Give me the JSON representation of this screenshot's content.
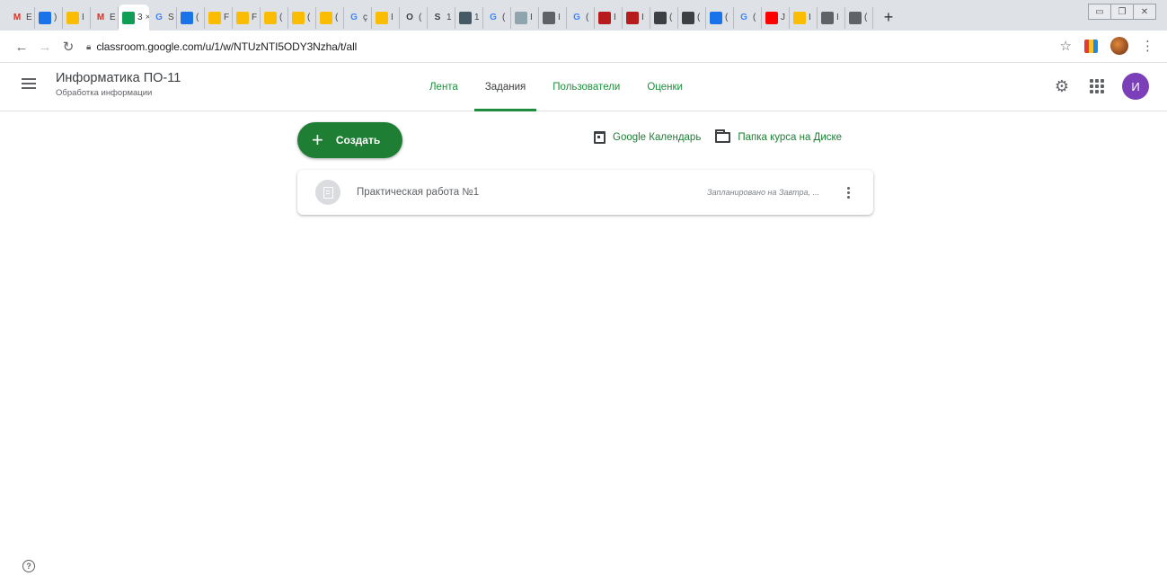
{
  "browser": {
    "tabs": [
      {
        "icon": "gmail-icon",
        "letter": "M",
        "color": "#d93025",
        "text": "E"
      },
      {
        "icon": "classroom-icon",
        "letter": "",
        "color": "#1a73e8",
        "text": ")"
      },
      {
        "icon": "classroom-icon",
        "letter": "",
        "color": "#fbbc04",
        "text": "I"
      },
      {
        "icon": "gmail-icon",
        "letter": "M",
        "color": "#d93025",
        "text": "E"
      },
      {
        "icon": "classroom-icon",
        "letter": "",
        "color": "#0f9d58",
        "text": "3",
        "active": true
      },
      {
        "icon": "google-icon",
        "letter": "G",
        "color": "#4285f4",
        "text": "S"
      },
      {
        "icon": "classroom-icon",
        "letter": "",
        "color": "#1a73e8",
        "text": "("
      },
      {
        "icon": "classroom-icon",
        "letter": "",
        "color": "#fbbc04",
        "text": "F"
      },
      {
        "icon": "classroom-icon",
        "letter": "",
        "color": "#fbbc04",
        "text": "F"
      },
      {
        "icon": "classroom-icon",
        "letter": "",
        "color": "#fbbc04",
        "text": "("
      },
      {
        "icon": "classroom-icon",
        "letter": "",
        "color": "#fbbc04",
        "text": "("
      },
      {
        "icon": "classroom-icon",
        "letter": "",
        "color": "#fbbc04",
        "text": "("
      },
      {
        "icon": "google-icon",
        "letter": "G",
        "color": "#4285f4",
        "text": "ç"
      },
      {
        "icon": "classroom-icon",
        "letter": "",
        "color": "#fbbc04",
        "text": "I"
      },
      {
        "icon": "site-icon",
        "letter": "O",
        "color": "#3c4043",
        "text": "("
      },
      {
        "icon": "site-icon",
        "letter": "S",
        "color": "#3c4043",
        "text": "1"
      },
      {
        "icon": "site-icon",
        "letter": "",
        "color": "#455a64",
        "text": "1"
      },
      {
        "icon": "google-icon",
        "letter": "G",
        "color": "#4285f4",
        "text": "("
      },
      {
        "icon": "site-icon",
        "letter": "",
        "color": "#90a4ae",
        "text": "I"
      },
      {
        "icon": "site-icon",
        "letter": "",
        "color": "#5f6368",
        "text": "I"
      },
      {
        "icon": "google-icon",
        "letter": "G",
        "color": "#4285f4",
        "text": "("
      },
      {
        "icon": "site-icon",
        "letter": "",
        "color": "#b71c1c",
        "text": "I"
      },
      {
        "icon": "site-icon",
        "letter": "",
        "color": "#b71c1c",
        "text": "I"
      },
      {
        "icon": "site-icon",
        "letter": "",
        "color": "#3c4043",
        "text": "("
      },
      {
        "icon": "site-icon",
        "letter": "",
        "color": "#3c4043",
        "text": "("
      },
      {
        "icon": "site-icon",
        "letter": "",
        "color": "#1a73e8",
        "text": "("
      },
      {
        "icon": "google-icon",
        "letter": "G",
        "color": "#4285f4",
        "text": "("
      },
      {
        "icon": "youtube-icon",
        "letter": "",
        "color": "#ff0000",
        "text": "J"
      },
      {
        "icon": "site-icon",
        "letter": "",
        "color": "#fbbc04",
        "text": "I"
      },
      {
        "icon": "site-icon",
        "letter": "",
        "color": "#5f6368",
        "text": "I"
      },
      {
        "icon": "site-icon",
        "letter": "",
        "color": "#5f6368",
        "text": "("
      }
    ],
    "active_tab_close": "×",
    "new_tab": "+",
    "url": "classroom.google.com/u/1/w/NTUzNTI5ODY3Nzha/t/all"
  },
  "header": {
    "course_title": "Информатика ПО-11",
    "course_subtitle": "Обработка информации",
    "tabs": [
      {
        "label": "Лента",
        "active": false
      },
      {
        "label": "Задания",
        "active": true
      },
      {
        "label": "Пользователи",
        "active": false
      },
      {
        "label": "Оценки",
        "active": false
      }
    ],
    "avatar_letter": "И",
    "avatar_color": "#7b3fb8"
  },
  "toolbar": {
    "create_label": "Создать",
    "calendar_link": "Google Календарь",
    "drive_link": "Папка курса на Диске"
  },
  "assignments": [
    {
      "title": "Практическая работа №1",
      "status": "Запланировано на Завтра, ..."
    }
  ],
  "colors": {
    "accent_green": "#1e7e34"
  }
}
